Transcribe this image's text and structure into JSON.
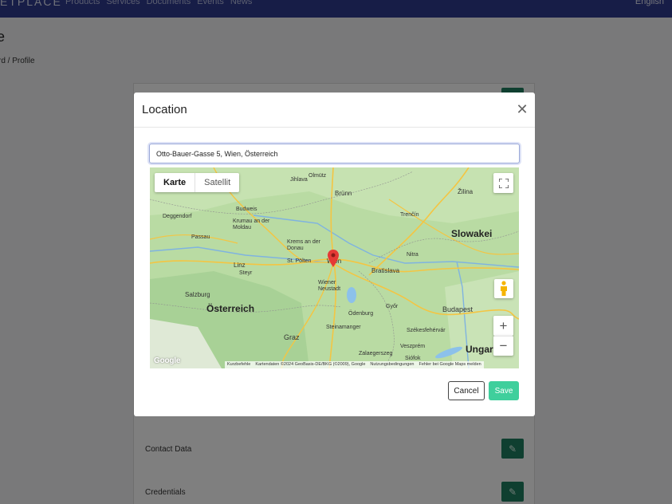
{
  "topnav": {
    "logo": "ETPLACE",
    "items": [
      "Products",
      "Services",
      "Documents",
      "Events",
      "News"
    ],
    "language": "English"
  },
  "page": {
    "title": "e",
    "breadcrumb": "rd  /  Profile"
  },
  "card": {
    "rows": [
      "Contact Data",
      "Credentials"
    ]
  },
  "modal": {
    "title": "Location",
    "address_value": "Otto-Bauer-Gasse 5, Wien, Österreich",
    "cancel_label": "Cancel",
    "save_label": "Save"
  },
  "map": {
    "type_options": [
      "Karte",
      "Satellit"
    ],
    "selected_type": "Karte",
    "labels": {
      "jihlava": "Jihlava",
      "olmutz": "Olmütz",
      "brunn": "Brünn",
      "zilina": "Žilina",
      "deggendorf": "Deggendorf",
      "budweis": "Budweis",
      "trencin": "Trenčín",
      "passau": "Passau",
      "krumau": "Krumau an der Moldau",
      "slowakei": "Slowakei",
      "krems": "Krems an der Donau",
      "linz": "Linz",
      "stpolten": "St. Pölten",
      "wien": "Wien",
      "nitra": "Nitra",
      "steyr": "Steyr",
      "bratislava": "Bratislava",
      "wiener_neustadt": "Wiener Neustadt",
      "salzburg": "Salzburg",
      "osterreich": "Österreich",
      "gyor": "Győr",
      "budapest": "Budapest",
      "steinamanger": "Steinamanger",
      "szekesfehervar": "Székesfehérvár",
      "graz": "Graz",
      "zalaegerszeg": "Zalaegerszeg",
      "veszprem": "Veszprém",
      "siofok": "Siófok",
      "ungarn": "Ungarn",
      "odenburg": "Ödenburg"
    },
    "attribution": {
      "shortcuts": "Kurzbefehle",
      "data": "Kartendaten ©2024 GeoBasis-DE/BKG (©2009), Google",
      "terms": "Nutzungsbedingungen",
      "report": "Fehler bei Google Maps melden"
    },
    "logo": "Google"
  },
  "colors": {
    "nav_bg": "#2f3a8f",
    "save_bg": "#3fcf9c",
    "edit_bg": "#1e7f60",
    "map_land": "#b9dba3",
    "pin": "#e53935"
  },
  "icons": {
    "close": "close-icon",
    "fullscreen": "fullscreen-icon",
    "pegman": "pegman-icon",
    "zoom_in": "plus-icon",
    "zoom_out": "minus-icon",
    "pin": "map-pin-icon",
    "edit": "pencil-icon"
  }
}
